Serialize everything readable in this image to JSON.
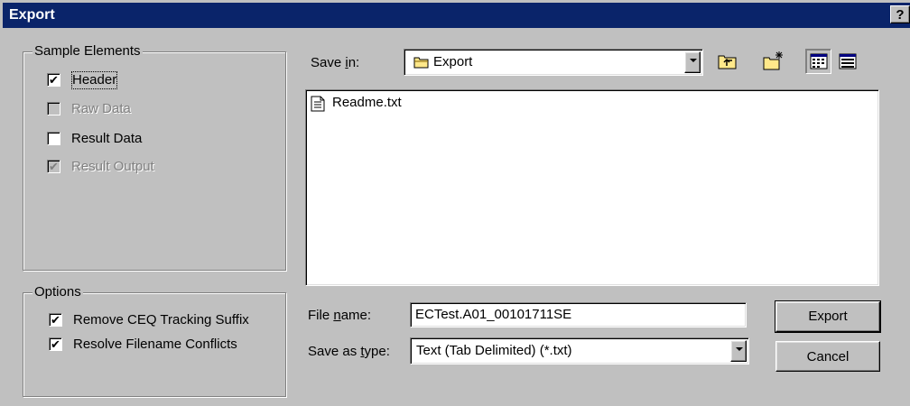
{
  "window": {
    "title": "Export",
    "help_label": "?",
    "close_label": "✕"
  },
  "sample_elements": {
    "legend": "Sample Elements",
    "items": [
      {
        "label": "Header",
        "checked": true,
        "enabled": true
      },
      {
        "label": "Raw Data",
        "checked": false,
        "enabled": false
      },
      {
        "label": "Result Data",
        "checked": false,
        "enabled": true
      },
      {
        "label": "Result Output",
        "checked": true,
        "enabled": false
      }
    ]
  },
  "options": {
    "legend": "Options",
    "items": [
      {
        "label": "Remove CEQ Tracking Suffix",
        "checked": true
      },
      {
        "label": "Resolve Filename Conflicts",
        "checked": true
      }
    ]
  },
  "save_in": {
    "label_prefix": "Save ",
    "label_accel": "i",
    "label_suffix": "n:",
    "value": "Export",
    "icons": [
      "folder-icon",
      "up-one-level-icon",
      "new-folder-icon",
      "list-view-icon",
      "details-view-icon"
    ]
  },
  "file_list": {
    "items": [
      {
        "name": "Readme.txt",
        "icon": "text-file-icon"
      }
    ]
  },
  "file_name": {
    "label_prefix": "File ",
    "label_accel": "n",
    "label_suffix": "ame:",
    "value": "ECTest.A01_00101711SE"
  },
  "save_as_type": {
    "label_prefix": "Save as ",
    "label_accel": "t",
    "label_suffix": "ype:",
    "value": "Text (Tab Delimited) (*.txt)"
  },
  "buttons": {
    "export_label": "Export",
    "cancel_label": "Cancel"
  },
  "check_mark": "✔"
}
